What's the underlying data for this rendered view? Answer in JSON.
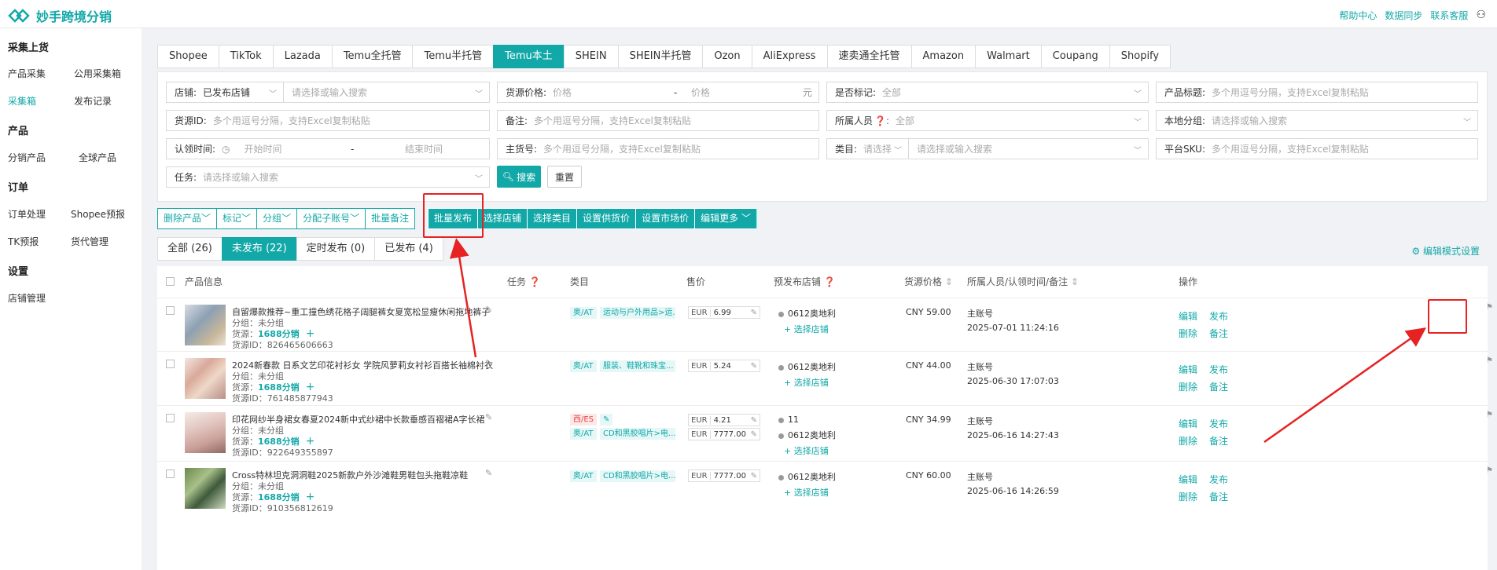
{
  "app": {
    "title": "妙手跨境分销",
    "brand_color": "#13a8a8"
  },
  "topbar": {
    "links": [
      "帮助中心",
      "数据同步",
      "联系客服"
    ]
  },
  "sidebar": {
    "groups": [
      {
        "title": "采集上货",
        "items": [
          "产品采集",
          "公用采集箱",
          "采集箱",
          "发布记录"
        ]
      },
      {
        "title": "产品",
        "items": [
          "分销产品",
          "全球产品"
        ]
      },
      {
        "title": "订单",
        "items": [
          "订单处理",
          "Shopee预报",
          "TK预报",
          "货代管理"
        ]
      },
      {
        "title": "设置",
        "items": [
          "店铺管理"
        ]
      }
    ],
    "active": "采集箱"
  },
  "platform_tabs": [
    "Shopee",
    "TikTok",
    "Lazada",
    "Temu全托管",
    "Temu半托管",
    "Temu本土",
    "SHEIN",
    "SHEIN半托管",
    "Ozon",
    "AliExpress",
    "速卖通全托管",
    "Amazon",
    "Walmart",
    "Coupang",
    "Shopify"
  ],
  "active_platform": "Temu本土",
  "filters": {
    "shop_label": "店铺:",
    "shop_select": "已发布店铺",
    "shop_ph": "请选择或输入搜索",
    "price_label": "货源价格:",
    "price_min_ph": "价格",
    "price_sep": "-",
    "price_max_ph": "价格",
    "price_unit": "元",
    "marked_label": "是否标记:",
    "marked_val": "全部",
    "title_label": "产品标题:",
    "title_ph": "多个用逗号分隔，支持Excel复制粘贴",
    "srcid_label": "货源ID:",
    "srcid_ph": "多个用逗号分隔，支持Excel复制粘贴",
    "note_label": "备注:",
    "note_ph": "多个用逗号分隔，支持Excel复制粘贴",
    "owner_label": "所属人员",
    "owner_val": "全部",
    "group_label": "本地分组:",
    "group_ph": "请选择或输入搜索",
    "time_label": "认领时间:",
    "time_start": "开始时间",
    "time_sep": "-",
    "time_end": "结束时间",
    "sku_main_label": "主货号:",
    "sku_main_ph": "多个用逗号分隔，支持Excel复制粘贴",
    "cat_label": "类目:",
    "cat_select": "请选择",
    "cat_ph": "请选择或输入搜索",
    "psku_label": "平台SKU:",
    "psku_ph": "多个用逗号分隔，支持Excel复制粘贴",
    "task_label": "任务:",
    "task_ph": "请选择或输入搜索",
    "search_btn": "搜索",
    "reset_btn": "重置"
  },
  "actions_left": [
    "删除产品",
    "标记",
    "分组",
    "分配子账号",
    "批量备注"
  ],
  "actions_right": [
    "批量发布",
    "选择店铺",
    "选择类目",
    "设置供货价",
    "设置市场价",
    "编辑更多"
  ],
  "status_tabs": [
    "全部 (26)",
    "未发布 (22)",
    "定时发布 (0)",
    "已发布 (4)"
  ],
  "active_status": "未发布 (22)",
  "edit_mode": "编辑模式设置",
  "columns": [
    "产品信息",
    "任务",
    "类目",
    "售价",
    "预发布店铺",
    "货源价格",
    "所属人员/认领时间/备注",
    "操作"
  ],
  "rows": [
    {
      "title": "自留爆款推荐~重工撞色绣花格子阔腿裤女夏宽松显瘦休闲拖地裤子",
      "group": "分组：未分组",
      "src_label": "货源：",
      "src": "1688分销",
      "srcid": "货源ID：826465606663",
      "cats": [
        {
          "region": "奥/AT",
          "name": "运动与户外用品>运..."
        }
      ],
      "prices": [
        {
          "cur": "EUR",
          "val": "6.99"
        }
      ],
      "shops": [
        "0612奥地利"
      ],
      "select_shop": "+ 选择店铺",
      "cost": "CNY 59.00",
      "owner": "主账号",
      "time": "2025-07-01 11:24:16",
      "ops": [
        "编辑",
        "发布",
        "删除",
        "备注"
      ]
    },
    {
      "title": "2024新春款 日系文艺印花衬衫女 学院风萝莉女衬衫百搭长袖棉衬衣",
      "group": "分组：未分组",
      "src_label": "货源：",
      "src": "1688分销",
      "srcid": "货源ID：761485877943",
      "cats": [
        {
          "region": "奥/AT",
          "name": "服装、鞋靴和珠宝..."
        }
      ],
      "prices": [
        {
          "cur": "EUR",
          "val": "5.24"
        }
      ],
      "shops": [
        "0612奥地利"
      ],
      "select_shop": "+ 选择店铺",
      "cost": "CNY 44.00",
      "owner": "主账号",
      "time": "2025-06-30 17:07:03",
      "ops": [
        "编辑",
        "发布",
        "删除",
        "备注"
      ]
    },
    {
      "title": "印花网纱半身裙女春夏2024新中式纱裙中长款垂感百褶裙A字长裙",
      "group": "分组：未分组",
      "src_label": "货源：",
      "src": "1688分销",
      "srcid": "货源ID：922649355897",
      "cats": [
        {
          "region": "西/ES",
          "name": ""
        },
        {
          "region": "奥/AT",
          "name": "CD和黑胶唱片>电..."
        }
      ],
      "prices": [
        {
          "cur": "EUR",
          "val": "4.21"
        },
        {
          "cur": "EUR",
          "val": "7777.00"
        }
      ],
      "shops": [
        "11",
        "0612奥地利"
      ],
      "select_shop": "+ 选择店铺",
      "cost": "CNY 34.99",
      "owner": "主账号",
      "time": "2025-06-16 14:27:43",
      "ops": [
        "编辑",
        "发布",
        "删除",
        "备注"
      ]
    },
    {
      "title": "Cross特林坦克洞洞鞋2025新款户外沙滩鞋男鞋包头拖鞋凉鞋",
      "group": "分组：未分组",
      "src_label": "货源：",
      "src": "1688分销",
      "srcid": "货源ID：910356812619",
      "cats": [
        {
          "region": "奥/AT",
          "name": "CD和黑胶唱片>电..."
        }
      ],
      "prices": [
        {
          "cur": "EUR",
          "val": "7777.00"
        }
      ],
      "shops": [
        "0612奥地利"
      ],
      "select_shop": "+ 选择店铺",
      "cost": "CNY 60.00",
      "owner": "主账号",
      "time": "2025-06-16 14:26:59",
      "ops": [
        "编辑",
        "发布",
        "删除",
        "备注"
      ]
    }
  ]
}
